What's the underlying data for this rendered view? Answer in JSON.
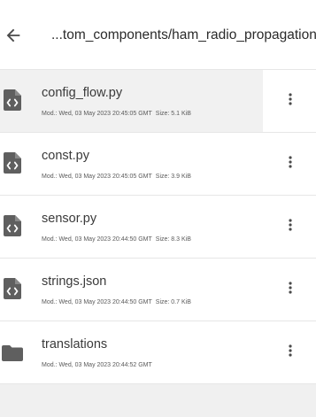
{
  "header": {
    "back_icon": "arrow-left-icon",
    "path": "...tom_components/ham_radio_propagation/"
  },
  "files": [
    {
      "name": "config_flow.py",
      "type": "file",
      "icon": "file-code-icon",
      "mod": "Mod.: Wed, 03 May 2023 20:45:05 GMT",
      "size": "Size: 5.1 KiB",
      "selected": true
    },
    {
      "name": "const.py",
      "type": "file",
      "icon": "file-code-icon",
      "mod": "Mod.: Wed, 03 May 2023 20:45:05 GMT",
      "size": "Size: 3.9 KiB",
      "selected": false
    },
    {
      "name": "sensor.py",
      "type": "file",
      "icon": "file-code-icon",
      "mod": "Mod.: Wed, 03 May 2023 20:44:50 GMT",
      "size": "Size: 8.3 KiB",
      "selected": false
    },
    {
      "name": "strings.json",
      "type": "file",
      "icon": "file-code-icon",
      "mod": "Mod.: Wed, 03 May 2023 20:44:50 GMT",
      "size": "Size: 0.7 KiB",
      "selected": false
    },
    {
      "name": "translations",
      "type": "folder",
      "icon": "folder-icon",
      "mod": "Mod.: Wed, 03 May 2023 20:44:52 GMT",
      "size": "",
      "selected": false
    }
  ],
  "colors": {
    "icon": "#5f5f5f",
    "background": "#f0f0f0",
    "selected_row": "#f1f1f1"
  }
}
